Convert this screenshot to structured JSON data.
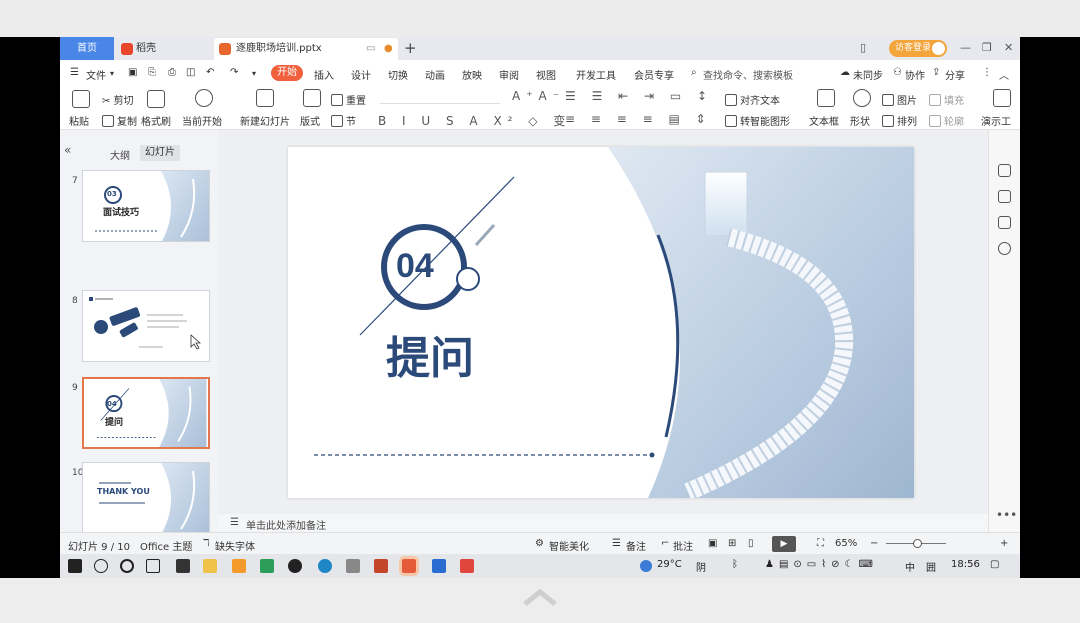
{
  "tabbar": {
    "home_tab": "首页",
    "shell_tab": "稻壳",
    "doc_tab": "逐鹿职场培训.pptx",
    "add_tab": "+",
    "login": "访客登录"
  },
  "menu": {
    "file": "文件",
    "items": [
      "开始",
      "插入",
      "设计",
      "切换",
      "动画",
      "放映",
      "审阅",
      "视图",
      "开发工具",
      "会员专享"
    ],
    "search": "查找命令、搜索模板",
    "sync": "未同步",
    "collab": "协作",
    "share": "分享"
  },
  "ribbon": {
    "paste": "粘贴",
    "cut": "剪切",
    "copy": "复制",
    "format_painter": "格式刷",
    "from_current": "当前开始",
    "new_slide": "新建幻灯片",
    "layout": "版式",
    "reset": "重置",
    "section": "节",
    "align_text": "对齐文本",
    "smart_art": "转智能图形",
    "textbox": "文本框",
    "shapes": "形状",
    "picture": "图片",
    "arrange": "排列",
    "fill": "填充",
    "outline": "轮廓",
    "present": "演示工"
  },
  "panel": {
    "outline_tab": "大纲",
    "slides_tab": "幻灯片",
    "thumbs": [
      {
        "num": "7",
        "circle": "03",
        "title": "面试技巧"
      },
      {
        "num": "8",
        "circle": "",
        "title": ""
      },
      {
        "num": "9",
        "circle": "04",
        "title": "提问"
      },
      {
        "num": "10",
        "circle": "",
        "title": "THANK YOU"
      }
    ],
    "add": "+"
  },
  "slide": {
    "number": "04",
    "title": "提问"
  },
  "notes": {
    "placeholder": "单击此处添加备注"
  },
  "status": {
    "slide_count": "幻灯片 9 / 10",
    "theme": "Office 主题",
    "missing_font": "缺失字体",
    "smart_beautify": "智能美化",
    "notes": "备注",
    "comments": "批注",
    "zoom": "65%"
  },
  "taskbar": {
    "temperature": "29°C",
    "weather": "阴",
    "ime": "中",
    "time": "18:56"
  },
  "colors": {
    "accent_blue": "#2b4a7a",
    "wps_orange": "#f0603c",
    "home_tab": "#4a86e8"
  }
}
